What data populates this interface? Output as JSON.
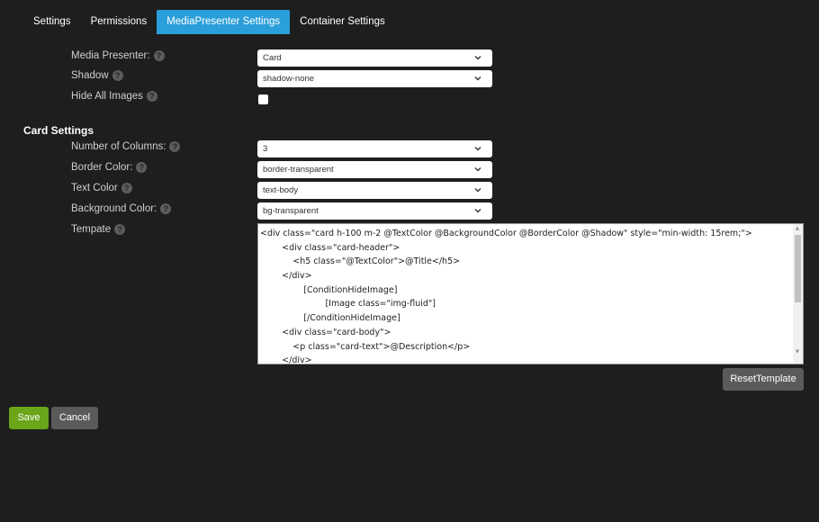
{
  "tabs": [
    {
      "label": "Settings",
      "active": false
    },
    {
      "label": "Permissions",
      "active": false
    },
    {
      "label": "MediaPresenter Settings",
      "active": true
    },
    {
      "label": "Container Settings",
      "active": false
    }
  ],
  "help_glyph": "?",
  "chevron_icon": "chevron-down-icon",
  "fields": {
    "media_presenter": {
      "label": "Media Presenter:",
      "value": "Card"
    },
    "shadow": {
      "label": "Shadow",
      "value": "shadow-none"
    },
    "hide_all_images": {
      "label": "Hide All Images",
      "checked": false
    }
  },
  "card_settings": {
    "title": "Card Settings",
    "number_of_columns": {
      "label": "Number of Columns:",
      "value": "3"
    },
    "border_color": {
      "label": "Border Color:",
      "value": "border-transparent"
    },
    "text_color": {
      "label": "Text Color",
      "value": "text-body"
    },
    "background_color": {
      "label": "Background Color:",
      "value": "bg-transparent"
    },
    "template": {
      "label": "Tempate",
      "lines": [
        "<div class=\"card h-100 m-2 @TextColor @BackgroundColor @BorderColor @Shadow\" style=\"min-width: 15rem;\">",
        "        <div class=\"card-header\">",
        "            <h5 class=\"@TextColor\">@Title</h5>",
        "        </div>",
        "                [ConditionHideImage]",
        "                        [Image class=\"img-fluid\"]",
        "                [/ConditionHideImage]",
        "        <div class=\"card-body\">",
        "            <p class=\"card-text\">@Description</p>",
        "        </div>"
      ]
    }
  },
  "buttons": {
    "reset_template": "ResetTemplate",
    "save": "Save",
    "cancel": "Cancel"
  },
  "colors": {
    "background": "#1e1e1e",
    "active_tab": "#2b9fd9",
    "save_button": "#6aa51a",
    "secondary_button": "#5a5a5a"
  }
}
